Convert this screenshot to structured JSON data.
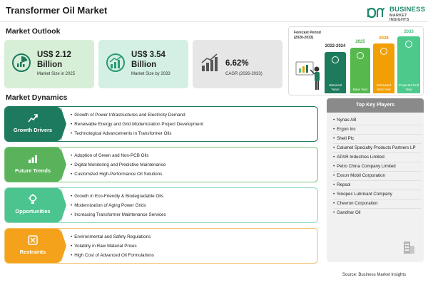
{
  "header": {
    "title": "Transformer Oil Market",
    "brand_line1": "BUSINESS",
    "brand_line2": "MARKET INSIGHTS"
  },
  "outlook": {
    "title": "Market Outlook",
    "cards": [
      {
        "value": "US$ 2.12 Billion",
        "caption": "Market Size in 2025",
        "icon": "pie-chart-icon",
        "color": "#d6efd6"
      },
      {
        "value": "US$ 3.54 Billion",
        "caption": "Market Size by 2033",
        "icon": "growth-chart-icon",
        "color": "#d4efe4"
      },
      {
        "value": "6.62%",
        "caption": "CAGR (2026-2033)",
        "icon": "trend-bar-icon",
        "color": "#e6e6e6"
      }
    ]
  },
  "forecast": {
    "label_line1": "Forecast Period",
    "label_line2": "(2026-2033)",
    "bars": [
      {
        "tag": "2022-2024",
        "label": "Historical Years",
        "color": "#1d7a5c",
        "tag_color": "#333333"
      },
      {
        "tag": "2025",
        "label": "Base Year",
        "color": "#57b84e",
        "tag_color": "#4caf50"
      },
      {
        "tag": "2026",
        "label": "Estimated Start Year",
        "color": "#f29f05",
        "tag_color": "#e79400"
      },
      {
        "tag": "2033",
        "label": "Projected End Year",
        "color": "#4ec98c",
        "tag_color": "#3fbf80"
      }
    ]
  },
  "dynamics": {
    "title": "Market Dynamics",
    "rows": [
      {
        "label": "Growth Drivers",
        "icon": "growth-drivers-icon",
        "color": "#1e7a5f",
        "border": "#1e7a5f",
        "items": [
          "Growth of Power Infrastructures and Electricity Demand",
          "Renewable Energy and Grid Modernization Project Development",
          "Technological Advancements in Transformer Oils"
        ]
      },
      {
        "label": "Future Trends",
        "icon": "future-trends-icon",
        "color": "#5ab35a",
        "border": "#7cc47c",
        "items": [
          "Adoption of Green and Non-PCB Oils",
          "Digital Monitoring and Predictive Maintenance",
          "Customized High-Performance Oil Solutions"
        ]
      },
      {
        "label": "Opportunities",
        "icon": "opportunities-icon",
        "color": "#4cc490",
        "border": "#8fd8b6",
        "items": [
          "Growth in Eco-Friendly & Biodegradable Oils",
          "Modernization of Aging Power Grids",
          "Increasing Transformer Maintenance Services"
        ]
      },
      {
        "label": "Restraints",
        "icon": "restraints-icon",
        "color": "#f4a21c",
        "border": "#f4c26e",
        "items": [
          "Environmental and Safety Regulations",
          "Volatility in Raw Material Prices",
          "High Cost of Advanced Oil Formulations"
        ]
      }
    ]
  },
  "key_players": {
    "title": "Top Key Players",
    "items": [
      "Nynas AB",
      "Ergon Inc",
      "Shell Plc",
      "Calumet Specialty Products Partners LP",
      "APAR Industries Limited",
      "Petro China Company Limited",
      "Exxon Mobil Corporation",
      "Repsol",
      "Sinopec Lubricant Company",
      "Chevron Corporation",
      "Gandhar Oil"
    ]
  },
  "source": "Source: Business Market Insights"
}
